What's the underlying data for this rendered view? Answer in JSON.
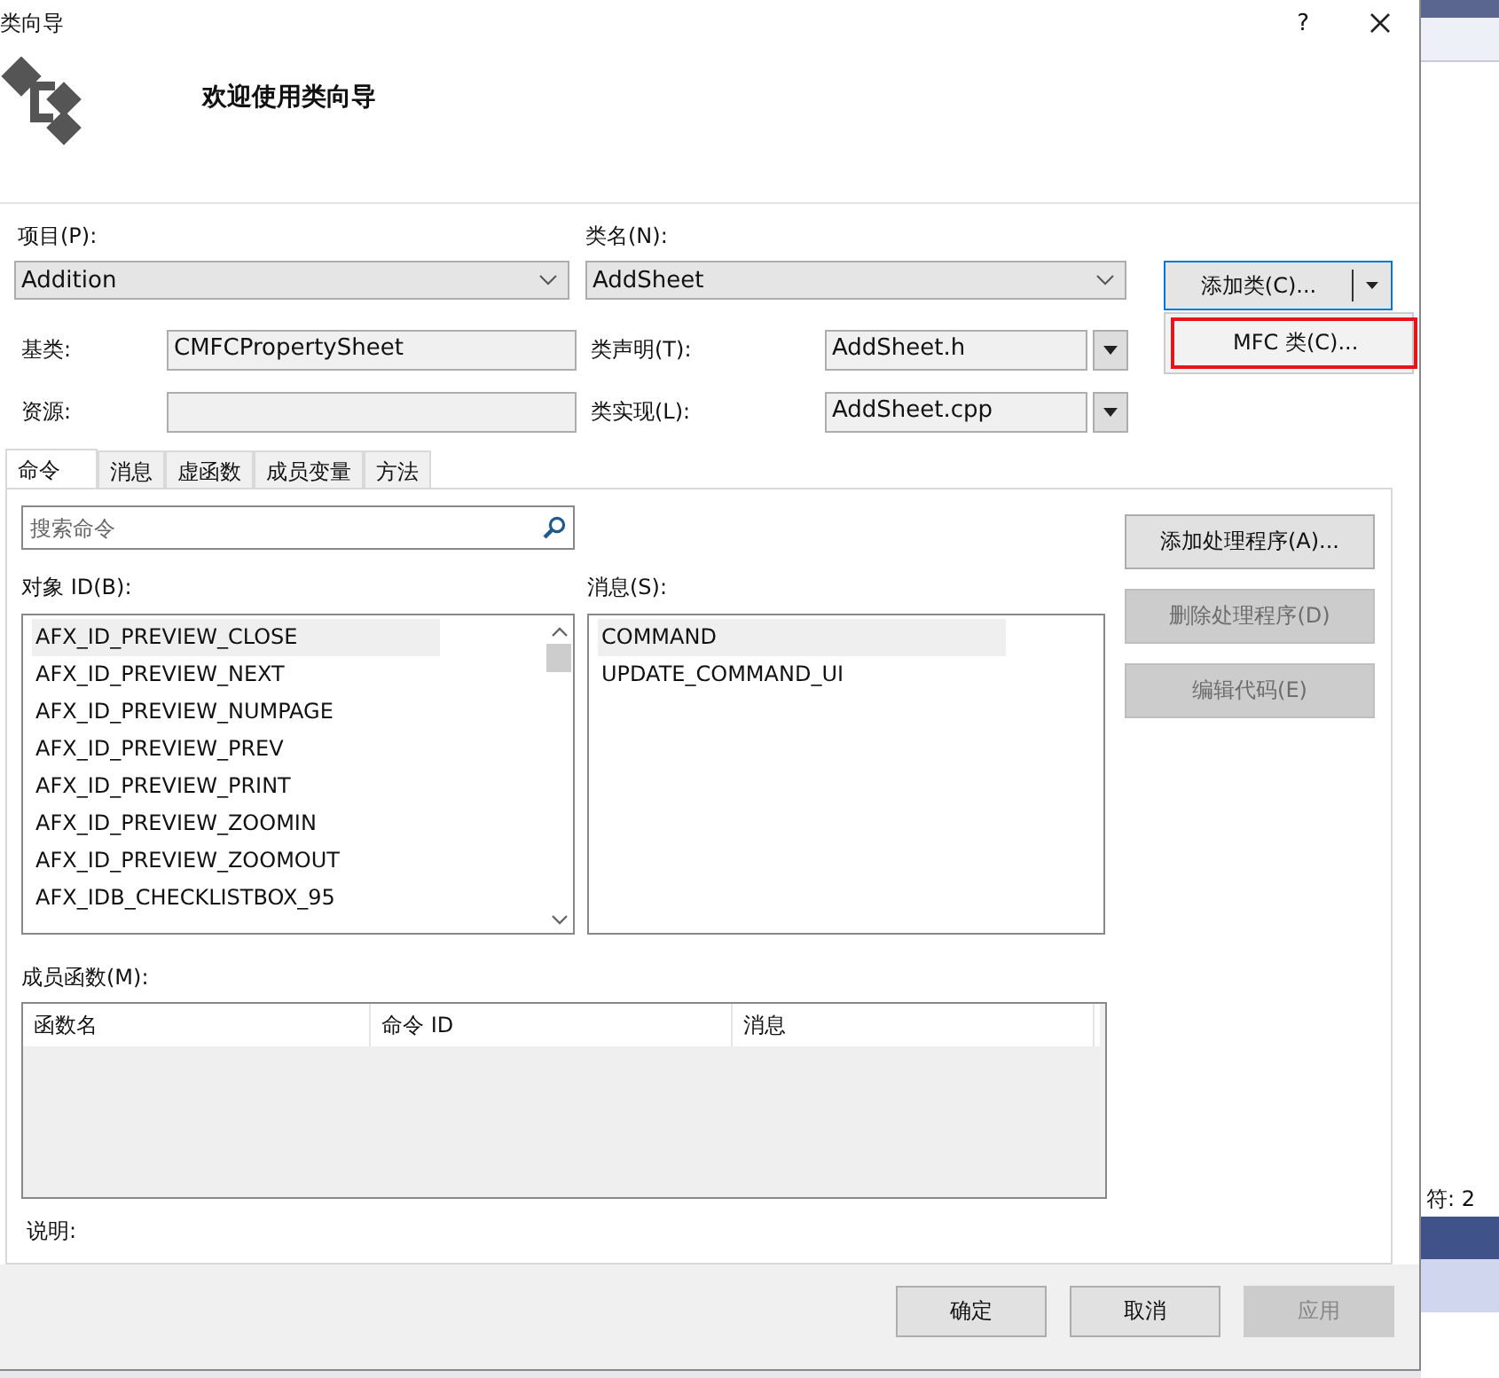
{
  "window": {
    "title": "类向导",
    "help": "?"
  },
  "header": {
    "heading": "欢迎使用类向导"
  },
  "project": {
    "label": "项目(P):",
    "value": "Addition"
  },
  "class_name": {
    "label": "类名(N):",
    "value": "AddSheet"
  },
  "add_class": {
    "label": "添加类(C)...",
    "menu": [
      {
        "label": "MFC 类(C)...",
        "highlighted": true
      }
    ]
  },
  "base_class": {
    "label": "基类:",
    "value": "CMFCPropertySheet"
  },
  "declaration": {
    "label": "类声明(T):",
    "value": "AddSheet.h"
  },
  "resource": {
    "label": "资源:"
  },
  "implementation": {
    "label": "类实现(L):",
    "value": "AddSheet.cpp"
  },
  "tabs": [
    {
      "label": "命令",
      "selected": true
    },
    {
      "label": "消息",
      "selected": false
    },
    {
      "label": "虚函数",
      "selected": false
    },
    {
      "label": "成员变量",
      "selected": false
    },
    {
      "label": "方法",
      "selected": false
    }
  ],
  "search": {
    "placeholder": "搜索命令"
  },
  "object_ids": {
    "label": "对象 ID(B):",
    "items": [
      {
        "label": "AFX_ID_PREVIEW_CLOSE",
        "selected": true
      },
      {
        "label": "AFX_ID_PREVIEW_NEXT",
        "selected": false
      },
      {
        "label": "AFX_ID_PREVIEW_NUMPAGE",
        "selected": false
      },
      {
        "label": "AFX_ID_PREVIEW_PREV",
        "selected": false
      },
      {
        "label": "AFX_ID_PREVIEW_PRINT",
        "selected": false
      },
      {
        "label": "AFX_ID_PREVIEW_ZOOMIN",
        "selected": false
      },
      {
        "label": "AFX_ID_PREVIEW_ZOOMOUT",
        "selected": false
      },
      {
        "label": "AFX_IDB_CHECKLISTBOX_95",
        "selected": false
      }
    ]
  },
  "messages": {
    "label": "消息(S):",
    "items": [
      {
        "label": "COMMAND",
        "selected": true
      },
      {
        "label": "UPDATE_COMMAND_UI",
        "selected": false
      }
    ]
  },
  "actions": [
    {
      "label": "添加处理程序(A)...",
      "disabled": false
    },
    {
      "label": "删除处理程序(D)",
      "disabled": true
    },
    {
      "label": "编辑代码(E)",
      "disabled": true
    }
  ],
  "member_functions": {
    "label": "成员函数(M):",
    "columns": [
      "函数名",
      "命令 ID",
      "消息"
    ]
  },
  "description": {
    "label": "说明:"
  },
  "buttons": [
    {
      "label": "确定",
      "disabled": false
    },
    {
      "label": "取消",
      "disabled": false
    },
    {
      "label": "应用",
      "disabled": true
    }
  ],
  "background": {
    "status_text": "符: 2"
  }
}
